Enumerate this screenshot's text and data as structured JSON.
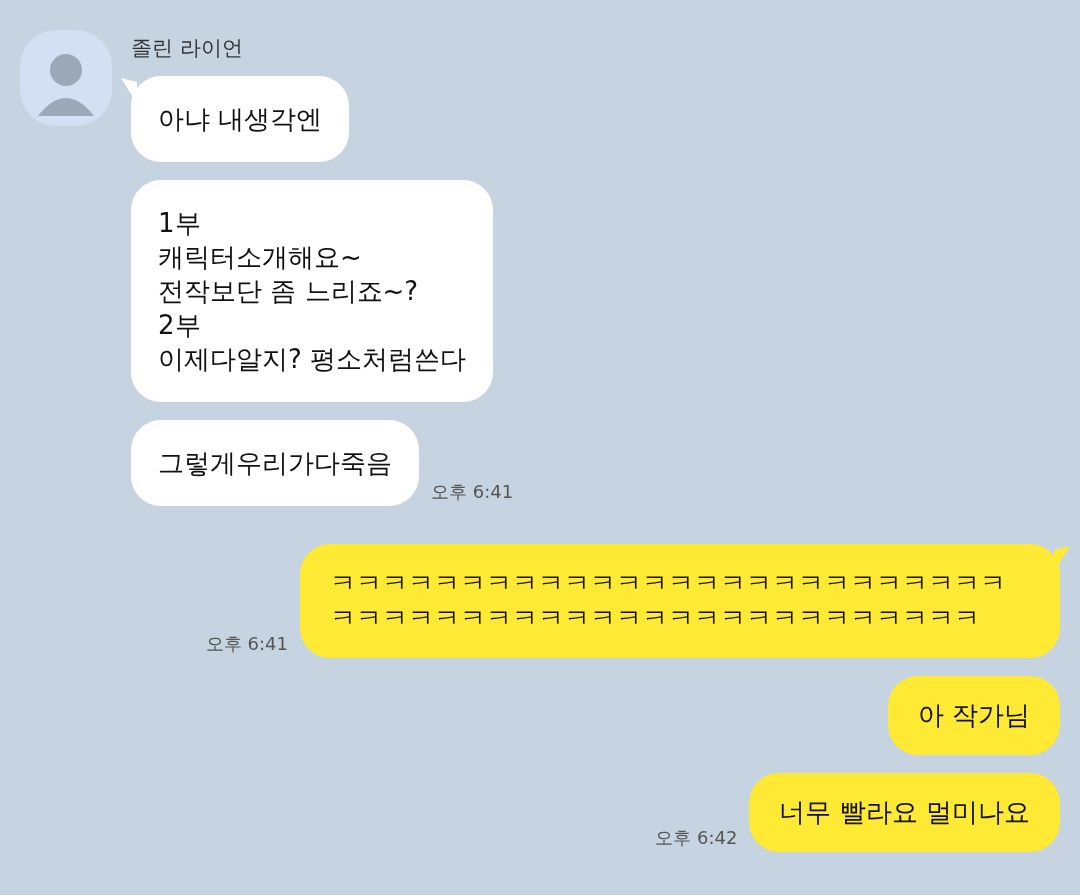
{
  "contact": {
    "name": "졸린 라이언"
  },
  "incoming": [
    {
      "text": "아냐 내생각엔"
    },
    {
      "text": "1부\n캐릭터소개해요~\n전작보단 좀 느리죠~?\n2부\n이제다알지? 평소처럼쓴다"
    },
    {
      "text": "그렇게우리가다죽음",
      "time": "오후 6:41"
    }
  ],
  "outgoing": [
    {
      "text": "ㅋㅋㅋㅋㅋㅋㅋㅋㅋㅋㅋㅋㅋㅋㅋㅋㅋㅋㅋㅋㅋㅋㅋㅋㅋㅋㅋㅋㅋㅋㅋㅋㅋㅋㅋㅋㅋㅋㅋㅋㅋㅋㅋㅋㅋㅋㅋㅋㅋㅋㅋ",
      "time": "오후 6:41"
    },
    {
      "text": "아 작가님"
    },
    {
      "text": "너무 빨라요 멀미나요",
      "time": "오후 6:42"
    }
  ]
}
